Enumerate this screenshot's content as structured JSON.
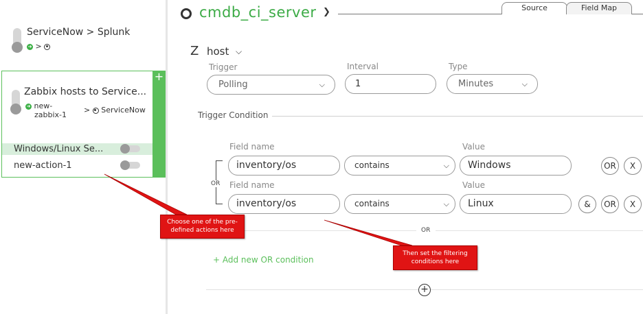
{
  "sidebar": {
    "flows": [
      {
        "title": "ServiceNow > Splunk",
        "path_sep": ">",
        "target": ""
      },
      {
        "title": "Zabbix hosts to Service...",
        "source_line1": "new-",
        "source_line2": "zabbix-1",
        "path_sep": ">",
        "target": "ServiceNow"
      }
    ],
    "add_label": "+",
    "actions": [
      {
        "label": "Windows/Linux Se...",
        "selected": true
      },
      {
        "label": "new-action-1",
        "selected": false
      }
    ]
  },
  "header": {
    "title": "cmdb_ci_server",
    "tabs": [
      {
        "label": "Source"
      },
      {
        "label": "Field Map"
      }
    ]
  },
  "trigger": {
    "letter": "Z",
    "name": "host",
    "fields": {
      "trigger_label": "Trigger",
      "trigger_value": "Polling",
      "interval_label": "Interval",
      "interval_value": "1",
      "type_label": "Type",
      "type_value": "Minutes"
    }
  },
  "condition": {
    "section_title": "Trigger Condition",
    "rows": [
      {
        "field_label": "Field name",
        "field_value": "inventory/os",
        "operator": "contains",
        "value_label": "Value",
        "value": "Windows",
        "buttons": [
          "OR",
          "X"
        ]
      },
      {
        "field_label": "Field name",
        "field_value": "inventory/os",
        "operator": "contains",
        "value_label": "Value",
        "value": "Linux",
        "buttons": [
          "&",
          "OR",
          "X"
        ]
      }
    ],
    "or_between": "OR",
    "or_divider": "OR",
    "add_or_label": "+ Add new OR condition",
    "add_block_label": "+"
  },
  "annotations": {
    "callout_actions": "Choose one of the pre-defined actions here",
    "callout_conditions": "Then set the filtering conditions here"
  },
  "colors": {
    "accent_green": "#3cab46",
    "callout_red": "#e01414"
  }
}
